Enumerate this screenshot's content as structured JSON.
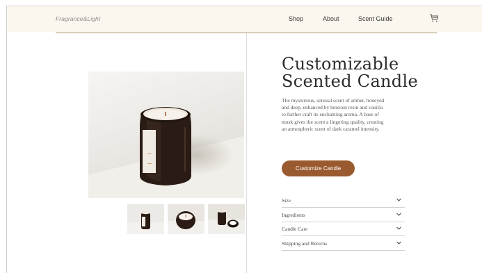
{
  "header": {
    "logo": "Fragrance&Light",
    "nav": [
      {
        "label": "Shop"
      },
      {
        "label": "About"
      },
      {
        "label": "Scent Guide"
      }
    ],
    "cart_icon": "cart-icon"
  },
  "product": {
    "title_line1": "Customizable",
    "title_line2": "Scented Candle",
    "description_lines": [
      "The mysterious, sensual scent of amber, honeyed",
      "and deep, enhanced by benzoin resin and vanilla",
      "to further craft its enchanting aroma. A base of",
      "musk gives the scent a lingering quality, creating",
      "an atmospheric scent of dark caramel intensity."
    ],
    "cta_label": "Customize Candle"
  },
  "accordion": [
    {
      "label": "Size",
      "icon": "chevron-down-icon"
    },
    {
      "label": "Ingredients",
      "icon": "chevron-down-icon"
    },
    {
      "label": "Candle Care",
      "icon": "chevron-down-icon"
    },
    {
      "label": "Shipping and Returns",
      "icon": "chevron-down-icon"
    }
  ],
  "colors": {
    "header_bg": "#fbf6ee",
    "accent": "#9a5a30",
    "text": "#2b2b2b"
  }
}
